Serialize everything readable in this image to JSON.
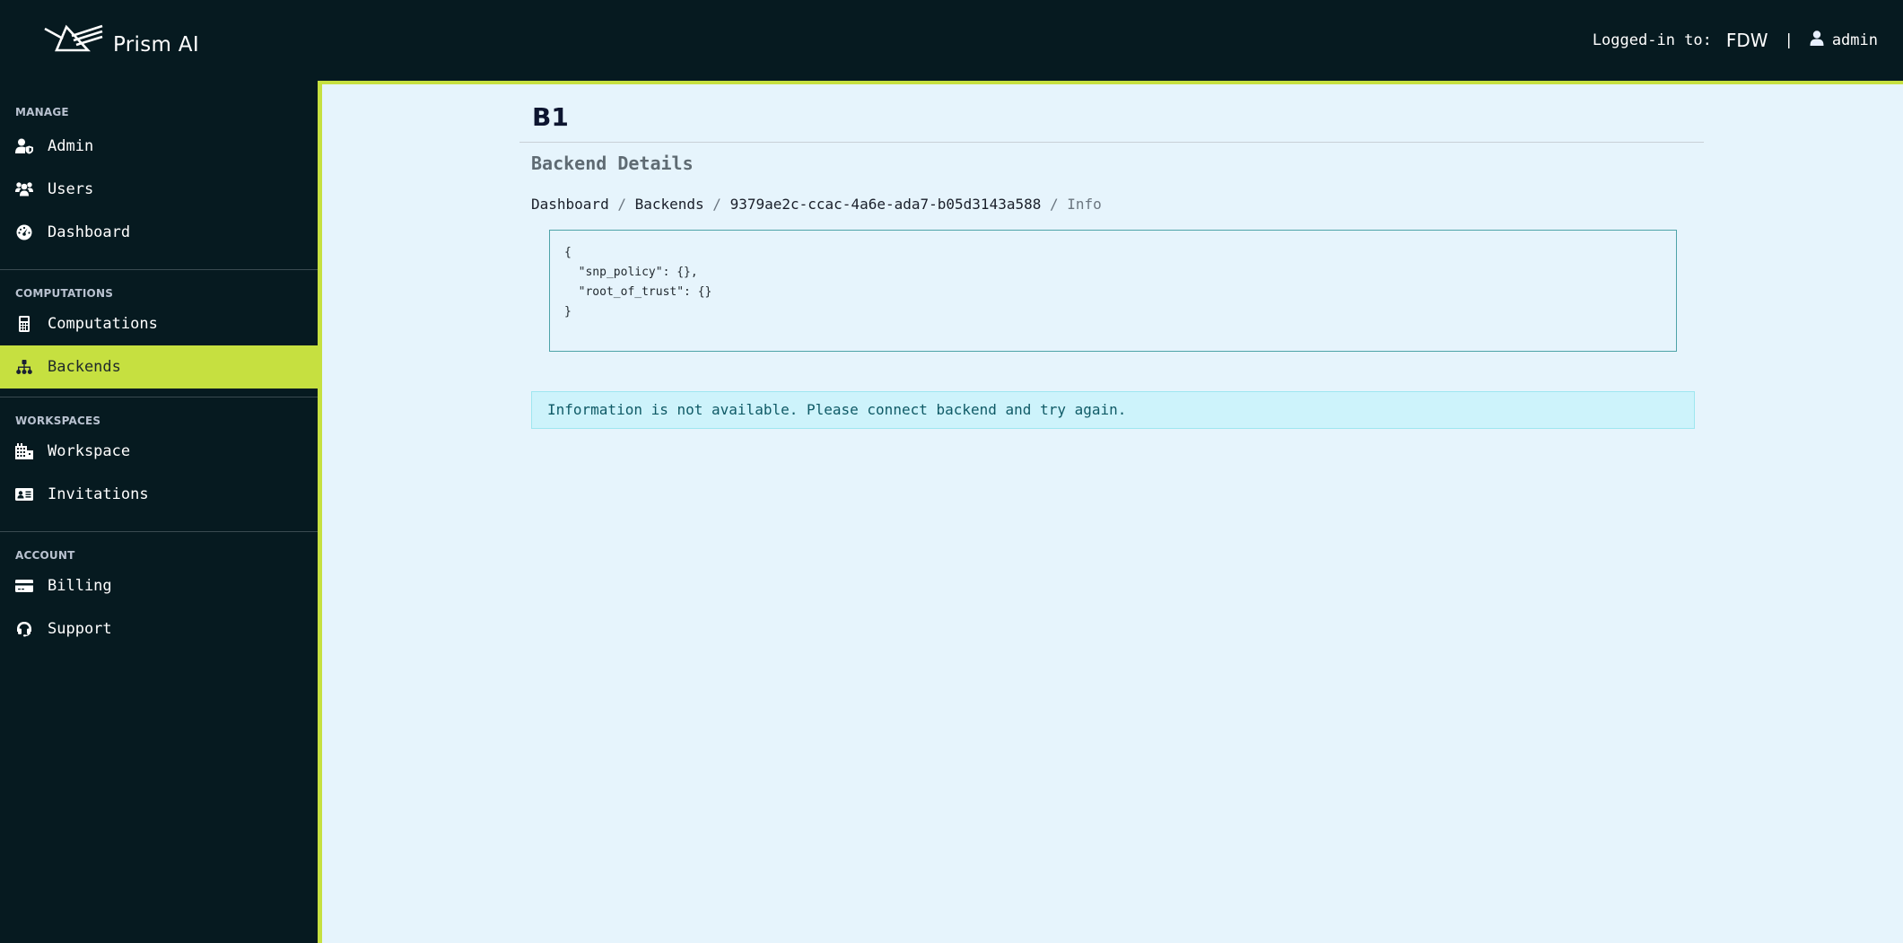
{
  "header": {
    "brand_name": "Prism AI",
    "logo_icon": "prism-logo-icon",
    "logged_in_label": "Logged-in to:",
    "organization": "FDW",
    "separator": "|",
    "user_icon": "user-icon",
    "username": "admin"
  },
  "sidebar": {
    "sections": [
      {
        "title": "MANAGE",
        "items": [
          {
            "label": "Admin",
            "icon": "user-shield-icon"
          },
          {
            "label": "Users",
            "icon": "users-icon"
          },
          {
            "label": "Dashboard",
            "icon": "gauge-icon"
          }
        ]
      },
      {
        "title": "COMPUTATIONS",
        "items": [
          {
            "label": "Computations",
            "icon": "calculator-icon"
          },
          {
            "label": "Backends",
            "icon": "sitemap-icon",
            "active": true
          }
        ]
      },
      {
        "title": "WORKSPACES",
        "items": [
          {
            "label": "Workspace",
            "icon": "building-icon"
          },
          {
            "label": "Invitations",
            "icon": "id-card-icon"
          }
        ]
      },
      {
        "title": "ACCOUNT",
        "items": [
          {
            "label": "Billing",
            "icon": "credit-card-icon"
          },
          {
            "label": "Support",
            "icon": "headset-icon"
          }
        ]
      }
    ]
  },
  "main": {
    "title": "B1",
    "subtitle": "Backend Details",
    "breadcrumb": {
      "items": [
        "Dashboard",
        "Backends",
        "9379ae2c-ccac-4a6e-ada7-b05d3143a588"
      ],
      "separator": " / ",
      "current": "Info"
    },
    "code": "{\n  \"snp_policy\": {},\n  \"root_of_trust\": {}\n}",
    "alert": "Information is not available. Please connect backend and try again."
  },
  "colors": {
    "sidebar_bg": "#061a20",
    "accent": "#c6e040",
    "main_bg": "#e6f4fc",
    "code_border": "#4ea3a8",
    "alert_bg": "#cdf3fb",
    "alert_text": "#0f5a66"
  }
}
